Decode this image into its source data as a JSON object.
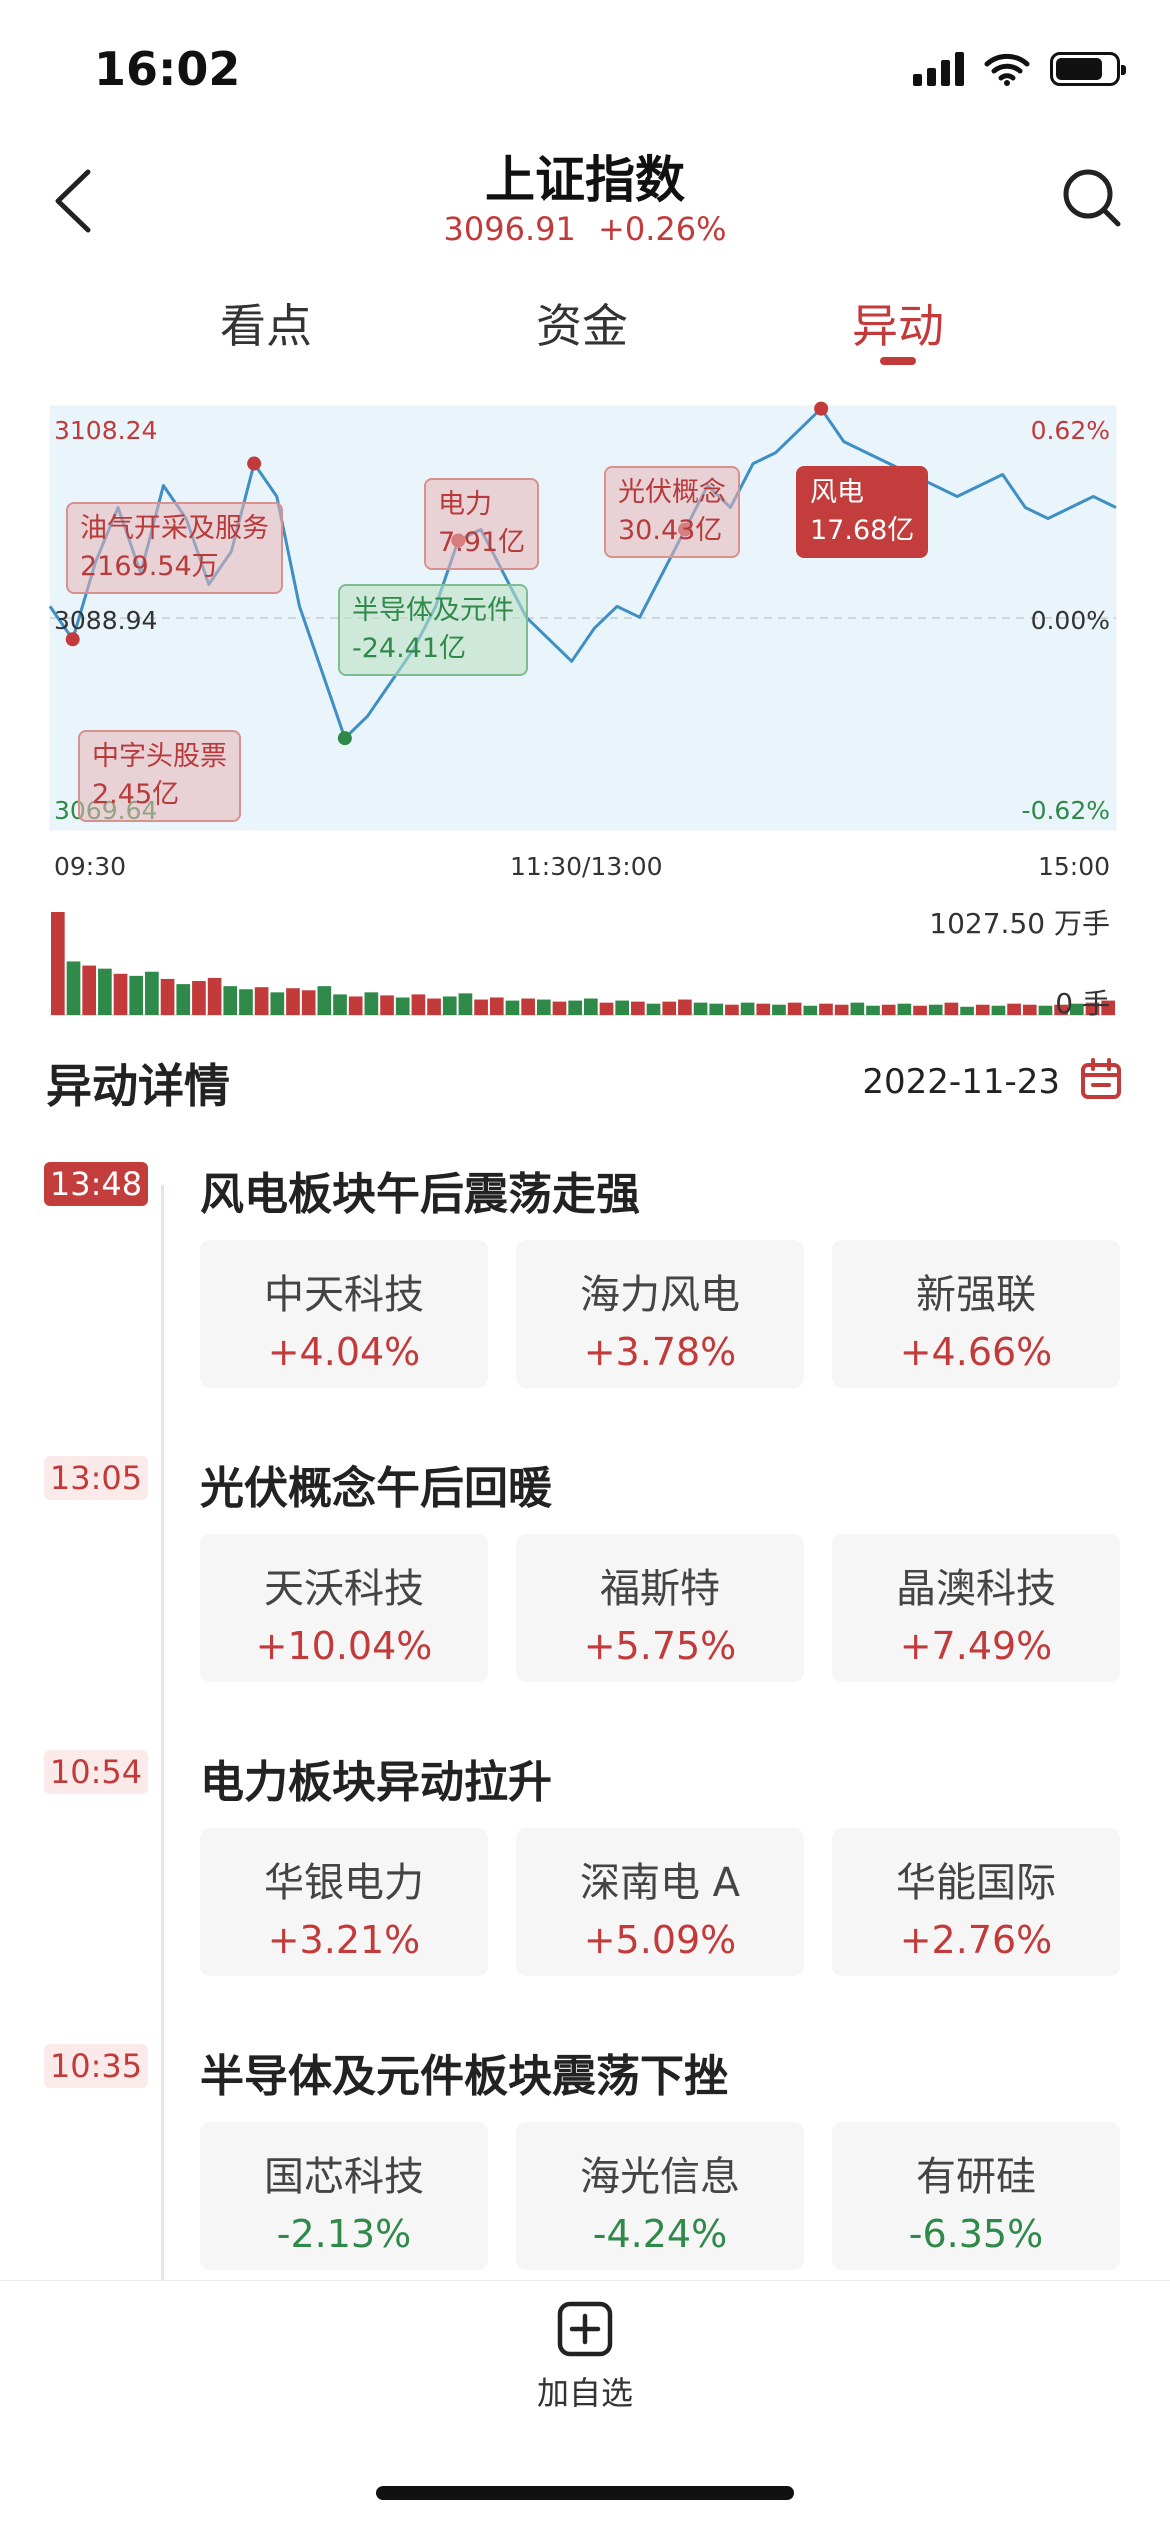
{
  "status_bar": {
    "time": "16:02",
    "icons": [
      "signal-icon",
      "wifi-icon",
      "battery-icon"
    ]
  },
  "header": {
    "title": "上证指数",
    "price": "3096.91",
    "change": "+0.26%",
    "back_icon": "chevron-left-icon",
    "search_icon": "search-icon"
  },
  "tabs": [
    {
      "label": "看点",
      "active": false
    },
    {
      "label": "资金",
      "active": false
    },
    {
      "label": "异动",
      "active": true
    }
  ],
  "chart_data": {
    "type": "line",
    "x_ticks": [
      "09:30",
      "11:30/13:00",
      "15:00"
    ],
    "y_left": {
      "high": "3108.24",
      "mid": "3088.94",
      "low": "3069.64"
    },
    "y_right": {
      "high": "0.62%",
      "mid": "0.00%",
      "low": "-0.62%"
    },
    "ylim": [
      3069.64,
      3108.24
    ],
    "series": [
      {
        "values": [
          3090,
          3087,
          3094,
          3099,
          3093,
          3101,
          3098,
          3092,
          3095,
          3103,
          3100,
          3090,
          3084,
          3078,
          3080,
          3083,
          3086,
          3090,
          3096,
          3097,
          3093,
          3089,
          3087,
          3085,
          3088,
          3090,
          3089,
          3093,
          3097,
          3101,
          3099,
          3103,
          3104,
          3106,
          3108,
          3105,
          3104,
          3103,
          3102,
          3101,
          3100,
          3101,
          3102,
          3099,
          3098,
          3099,
          3100,
          3099
        ]
      }
    ],
    "volume": {
      "max_label": "1027.50 万手",
      "min_label": "0 手",
      "values": [
        100,
        52,
        48,
        45,
        40,
        38,
        42,
        35,
        30,
        33,
        36,
        28,
        25,
        27,
        22,
        26,
        24,
        28,
        20,
        18,
        22,
        19,
        17,
        20,
        16,
        18,
        21,
        15,
        17,
        14,
        16,
        15,
        13,
        14,
        16,
        12,
        14,
        13,
        11,
        13,
        15,
        12,
        11,
        10,
        12,
        11,
        10,
        12,
        9,
        11,
        10,
        12,
        9,
        10,
        11,
        9,
        10,
        12,
        8,
        10,
        9,
        11,
        10,
        9,
        10,
        11,
        12,
        14
      ],
      "colors": [
        "r",
        "g",
        "r",
        "g",
        "r",
        "g",
        "g",
        "r",
        "g",
        "r",
        "r",
        "g",
        "g",
        "r",
        "g",
        "r",
        "r",
        "g",
        "g",
        "r",
        "g",
        "r",
        "g",
        "r",
        "r",
        "g",
        "g",
        "r",
        "r",
        "g",
        "r",
        "g",
        "r",
        "g",
        "g",
        "r",
        "g",
        "r",
        "g",
        "r",
        "r",
        "g",
        "g",
        "r",
        "g",
        "r",
        "g",
        "r",
        "g",
        "r",
        "r",
        "g",
        "g",
        "r",
        "g",
        "r",
        "g",
        "r",
        "g",
        "r",
        "g",
        "r",
        "r",
        "g",
        "r",
        "g",
        "r",
        "r"
      ]
    },
    "annotations": [
      {
        "label": "中字头股票",
        "value": "2.45亿",
        "tone": "red"
      },
      {
        "label": "油气开采及服务",
        "value": "2169.54万",
        "tone": "red"
      },
      {
        "label": "半导体及元件",
        "value": "-24.41亿",
        "tone": "green"
      },
      {
        "label": "电力",
        "value": "7.91亿",
        "tone": "red"
      },
      {
        "label": "光伏概念",
        "value": "30.43亿",
        "tone": "red"
      },
      {
        "label": "风电",
        "value": "17.68亿",
        "tone": "dark"
      }
    ],
    "colors": {
      "line": "#3e8fc4",
      "fill": "#eaf4fb",
      "up": "#c23a3a",
      "down": "#2f8a4a"
    }
  },
  "detail": {
    "title": "异动详情",
    "date": "2022-11-23",
    "calendar_icon": "calendar-icon",
    "events": [
      {
        "time": "13:48",
        "title": "风电板块午后震荡走强",
        "active": true,
        "stocks": [
          {
            "name": "中天科技",
            "change": "+4.04%",
            "dir": "up"
          },
          {
            "name": "海力风电",
            "change": "+3.78%",
            "dir": "up"
          },
          {
            "name": "新强联",
            "change": "+4.66%",
            "dir": "up"
          }
        ]
      },
      {
        "time": "13:05",
        "title": "光伏概念午后回暖",
        "active": false,
        "stocks": [
          {
            "name": "天沃科技",
            "change": "+10.04%",
            "dir": "up"
          },
          {
            "name": "福斯特",
            "change": "+5.75%",
            "dir": "up"
          },
          {
            "name": "晶澳科技",
            "change": "+7.49%",
            "dir": "up"
          }
        ]
      },
      {
        "time": "10:54",
        "title": "电力板块异动拉升",
        "active": false,
        "stocks": [
          {
            "name": "华银电力",
            "change": "+3.21%",
            "dir": "up"
          },
          {
            "name": "深南电 A",
            "change": "+5.09%",
            "dir": "up"
          },
          {
            "name": "华能国际",
            "change": "+2.76%",
            "dir": "up"
          }
        ]
      },
      {
        "time": "10:35",
        "title": "半导体及元件板块震荡下挫",
        "active": false,
        "stocks": [
          {
            "name": "国芯科技",
            "change": "-2.13%",
            "dir": "dn"
          },
          {
            "name": "海光信息",
            "change": "-4.24%",
            "dir": "dn"
          },
          {
            "name": "有研硅",
            "change": "-6.35%",
            "dir": "dn"
          }
        ]
      }
    ]
  },
  "bottom_bar": {
    "add_label": "加自选",
    "add_icon": "plus-square-icon"
  }
}
